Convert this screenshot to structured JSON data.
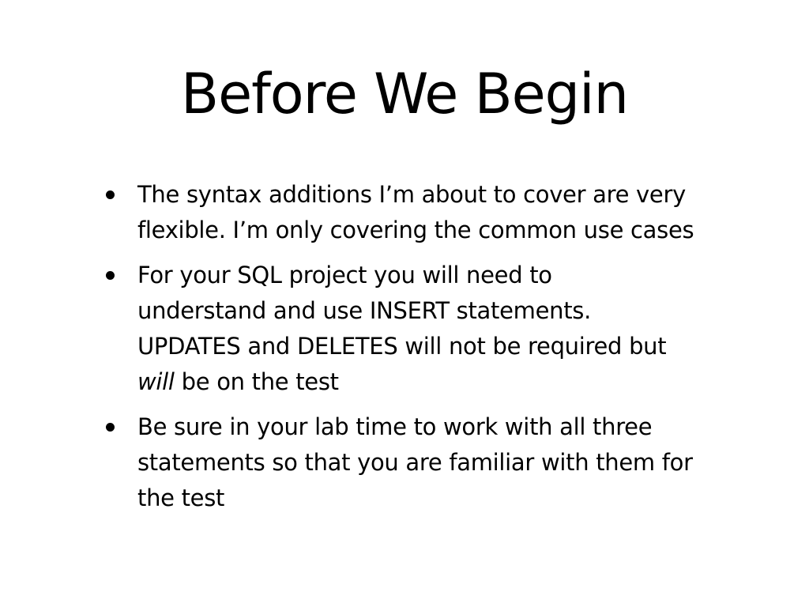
{
  "slide": {
    "title": "Before We Begin",
    "bullets": [
      {
        "lines": [
          "The syntax additions I’m about to cover are very",
          "flexible. I’m only covering the common use cases"
        ]
      },
      {
        "lines": [
          "For your SQL project you will need to",
          "understand and use INSERT statements.",
          "UPDATES and DELETES will not be required but"
        ],
        "last_line_emphasis": "will",
        "last_line_rest": " be on the test"
      },
      {
        "lines": [
          "Be sure in your lab time to work with all three",
          "statements so that you are familiar with them for",
          "the test"
        ]
      }
    ]
  }
}
